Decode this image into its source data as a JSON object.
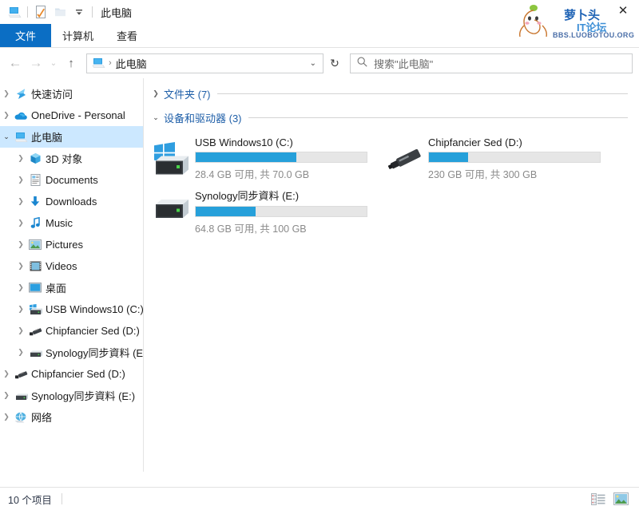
{
  "titlebar": {
    "title": "此电脑",
    "qat": [
      {
        "name": "this-pc-icon",
        "label": "此电脑"
      },
      {
        "name": "properties-icon",
        "label": "属性"
      },
      {
        "name": "new-folder-icon",
        "label": "新建文件夹"
      },
      {
        "name": "customize-qat-caret",
        "label": "自定义快速访问工具栏"
      }
    ],
    "close_label": "✕"
  },
  "watermark": {
    "line1": "萝卜头",
    "line2": "IT论坛",
    "line3": "BBS.LUOBOTOU.ORG"
  },
  "ribbon": {
    "tabs": [
      {
        "label": "文件",
        "active": true
      },
      {
        "label": "计算机",
        "active": false
      },
      {
        "label": "查看",
        "active": false
      }
    ]
  },
  "navbar": {
    "back_label": "←",
    "forward_label": "→",
    "recent_label": "⌄",
    "up_label": "↑",
    "address": {
      "crumb": "此电脑",
      "separator": "›",
      "caret": "⌄"
    },
    "refresh_label": "↻",
    "search": {
      "placeholder": "搜索\"此电脑\"",
      "icon": "search-icon"
    }
  },
  "sidebar": {
    "items": [
      {
        "label": "快速访问",
        "icon": "quick-access-icon",
        "chev": "collapsed",
        "indent": 1,
        "selected": false
      },
      {
        "label": "OneDrive - Personal",
        "icon": "onedrive-icon",
        "chev": "collapsed",
        "indent": 1,
        "selected": false
      },
      {
        "label": "此电脑",
        "icon": "this-pc-icon",
        "chev": "expanded",
        "indent": 1,
        "selected": true
      },
      {
        "label": "3D 对象",
        "icon": "3d-objects-icon",
        "chev": "collapsed",
        "indent": 2,
        "selected": false
      },
      {
        "label": "Documents",
        "icon": "documents-icon",
        "chev": "collapsed",
        "indent": 2,
        "selected": false
      },
      {
        "label": "Downloads",
        "icon": "downloads-icon",
        "chev": "collapsed",
        "indent": 2,
        "selected": false
      },
      {
        "label": "Music",
        "icon": "music-icon",
        "chev": "collapsed",
        "indent": 2,
        "selected": false
      },
      {
        "label": "Pictures",
        "icon": "pictures-icon",
        "chev": "collapsed",
        "indent": 2,
        "selected": false
      },
      {
        "label": "Videos",
        "icon": "videos-icon",
        "chev": "collapsed",
        "indent": 2,
        "selected": false
      },
      {
        "label": "桌面",
        "icon": "desktop-icon",
        "chev": "collapsed",
        "indent": 2,
        "selected": false
      },
      {
        "label": "USB Windows10 (C:)",
        "icon": "windows-drive-icon",
        "chev": "collapsed",
        "indent": 2,
        "selected": false
      },
      {
        "label": "Chipfancier Sed (D:)",
        "icon": "usb-drive-icon",
        "chev": "collapsed",
        "indent": 2,
        "selected": false
      },
      {
        "label": "Synology同步資料 (E:)",
        "icon": "hard-drive-icon",
        "chev": "collapsed",
        "indent": 2,
        "selected": false
      },
      {
        "label": "Chipfancier Sed (D:)",
        "icon": "usb-drive-icon",
        "chev": "collapsed",
        "indent": 1,
        "selected": false
      },
      {
        "label": "Synology同步資料 (E:)",
        "icon": "hard-drive-icon",
        "chev": "collapsed",
        "indent": 1,
        "selected": false
      },
      {
        "label": "网络",
        "icon": "network-icon",
        "chev": "collapsed",
        "indent": 1,
        "selected": false
      }
    ]
  },
  "content": {
    "groups": [
      {
        "title": "文件夹 (7)",
        "expanded": false
      },
      {
        "title": "设备和驱动器 (3)",
        "expanded": true
      }
    ],
    "drives": [
      {
        "name": "USB Windows10 (C:)",
        "icon": "windows-drive-icon",
        "free": "28.4 GB",
        "total": "70.0 GB",
        "sub": "28.4 GB 可用, 共 70.0 GB",
        "used_percent": 59,
        "bar_color": "#26a0da"
      },
      {
        "name": "Chipfancier Sed (D:)",
        "icon": "usb-stick-icon",
        "free": "230 GB",
        "total": "300 GB",
        "sub": "230 GB 可用, 共 300 GB",
        "used_percent": 23,
        "bar_color": "#26a0da"
      },
      {
        "name": "Synology同步資料 (E:)",
        "icon": "hard-drive-icon",
        "free": "64.8 GB",
        "total": "100 GB",
        "sub": "64.8 GB 可用, 共 100 GB",
        "used_percent": 35,
        "bar_color": "#26a0da"
      }
    ]
  },
  "statusbar": {
    "item_count": "10 个项目",
    "views": [
      {
        "name": "details-view-button",
        "label": "详细信息"
      },
      {
        "name": "large-icons-view-button",
        "label": "大图标"
      }
    ]
  },
  "colors": {
    "accent": "#0b6ec4",
    "bar_fill": "#26a0da",
    "selection": "#cce8ff",
    "group_title": "#1f5fa8"
  }
}
